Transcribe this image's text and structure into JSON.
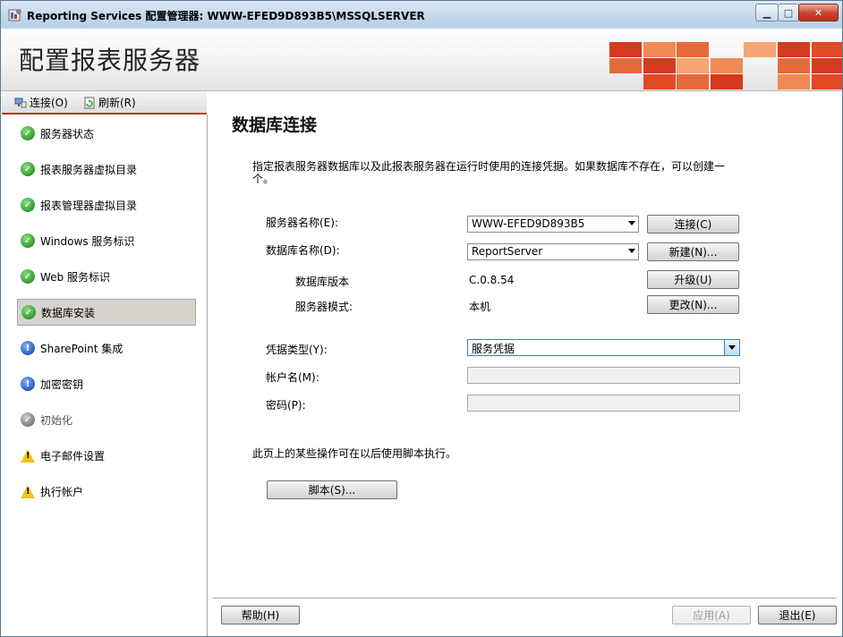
{
  "window": {
    "title": "Reporting Services 配置管理器: WWW-EFED9D893B5\\MSSQLSERVER",
    "minimize": "▁",
    "maximize": "□",
    "close": "✕"
  },
  "header": {
    "title": "配置报表服务器",
    "tile_colors": [
      "#d43a1f",
      "#e56a3a",
      "#f08a55",
      "#f5a572",
      "#e14a25"
    ]
  },
  "toolbar": {
    "connect_label": "连接(O)",
    "refresh_label": "刷新(R)"
  },
  "sidebar": {
    "items": [
      {
        "label": "服务器状态",
        "status": "ok"
      },
      {
        "label": "报表服务器虚拟目录",
        "status": "ok"
      },
      {
        "label": "报表管理器虚拟目录",
        "status": "ok"
      },
      {
        "label": "Windows 服务标识",
        "status": "ok"
      },
      {
        "label": "Web 服务标识",
        "status": "ok"
      },
      {
        "label": "数据库安装",
        "status": "ok",
        "selected": true
      },
      {
        "label": "SharePoint 集成",
        "status": "info"
      },
      {
        "label": "加密密钥",
        "status": "info"
      },
      {
        "label": "初始化",
        "status": "gray"
      },
      {
        "label": "电子邮件设置",
        "status": "warning"
      },
      {
        "label": "执行帐户",
        "status": "warning"
      }
    ]
  },
  "main": {
    "title": "数据库连接",
    "description": "指定报表服务器数据库以及此报表服务器在运行时使用的连接凭据。如果数据库不存在，可以创建一个。",
    "server_name_label": "服务器名称(E):",
    "server_name_value": "WWW-EFED9D893B5",
    "connect_button": "连接(C)",
    "database_name_label": "数据库名称(D):",
    "database_name_value": "ReportServer",
    "new_button": "新建(N)...",
    "db_version_label": "数据库版本",
    "db_version_value": "C.0.8.54",
    "upgrade_button": "升级(U)",
    "server_mode_label": "服务器模式:",
    "server_mode_value": "本机",
    "change_button": "更改(N)...",
    "credential_type_label": "凭据类型(Y):",
    "credential_type_value": "服务凭据",
    "account_label": "帐户名(M):",
    "account_value": "",
    "password_label": "密码(P):",
    "password_value": "",
    "script_note": "此页上的某些操作可在以后使用脚本执行。",
    "script_button": "脚本(S)...",
    "help_button": "帮助(H)",
    "apply_button": "应用(A)",
    "exit_button": "退出(E)"
  }
}
